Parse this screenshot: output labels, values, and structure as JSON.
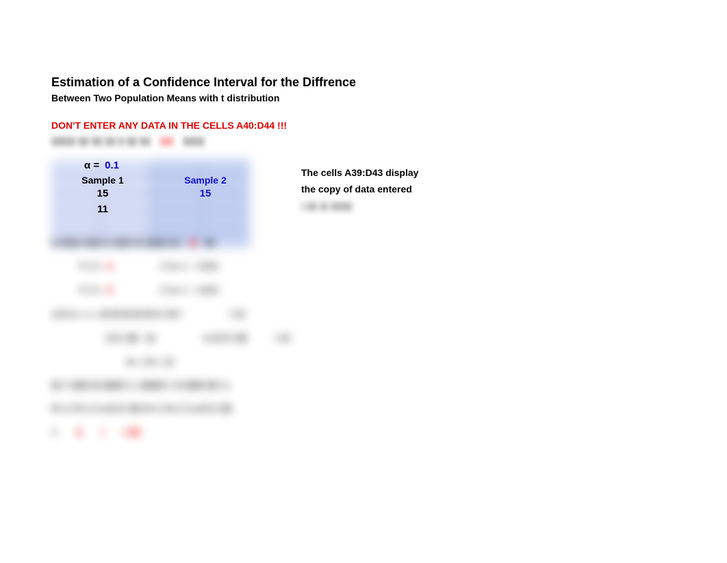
{
  "title1": "Estimation of a Confidence Interval for the Diffrence",
  "title2": "Between Two Population Means with t distribution",
  "warning": "DON'T ENTER ANY DATA IN THE CELLS  A40:D44 !!!",
  "blur_warn": {
    "a": "|||||||||  ||||  ||||  ||||  ||  ||||  ||||",
    "b": "|||||",
    "c": "||||||||"
  },
  "inputs": {
    "alpha_label": "α =",
    "alpha_value": "0.1",
    "sample1_label": "Sample 1",
    "sample2_label": "Sample 2",
    "n1": "15",
    "n2": "15",
    "v1": "11"
  },
  "right": {
    "l1": "The cells  A39:D43  display",
    "l2": "the copy of data entered",
    "lb": "| |||| ||| ||||||||"
  },
  "body": {
    "confline": {
      "a": "|| ||||||||  ||||||| || ||||||| ||| |||||||| |||  |",
      "b": "|||",
      "c": "||||"
    },
    "xbar_row1": {
      "a": "x̄ | | |",
      "b": "||",
      "c": "| | |₍ₙ₎ |",
      "d": "| |||||||"
    },
    "xbar_row2": {
      "a": "x̄ | | |",
      "b": "||",
      "c": "| | |₍ₙ₎ |",
      "d": "| |||||||"
    },
    "long1": {
      "a": ",|| || |₍ₙ₁₊ₙ₂₎ ||| |||  ||| ||| ||| || | ||| |",
      "b": "| ||||"
    },
    "pair": {
      "a": "|| || | ||||",
      "b": "||||",
      "c": "|₍ₙ₎|| || | ||||",
      "d": "| ||||"
    },
    "dof": "|n₁ | |n₂ | ||",
    "conc": "||| | | |||||| |||  |||||||| | |,  ||||||||| | |  || ||||||| |||| | |,",
    "fin1": "|x̄₁| | |x̄₂| | |₍ₙ₎|| || | ||||  |x̄₁| | |x̄₂| | |₍ₙ₎|| || | ||||",
    "result": {
      "a": "||",
      "b": "||",
      "c": "|",
      "d": "| ||||"
    }
  }
}
